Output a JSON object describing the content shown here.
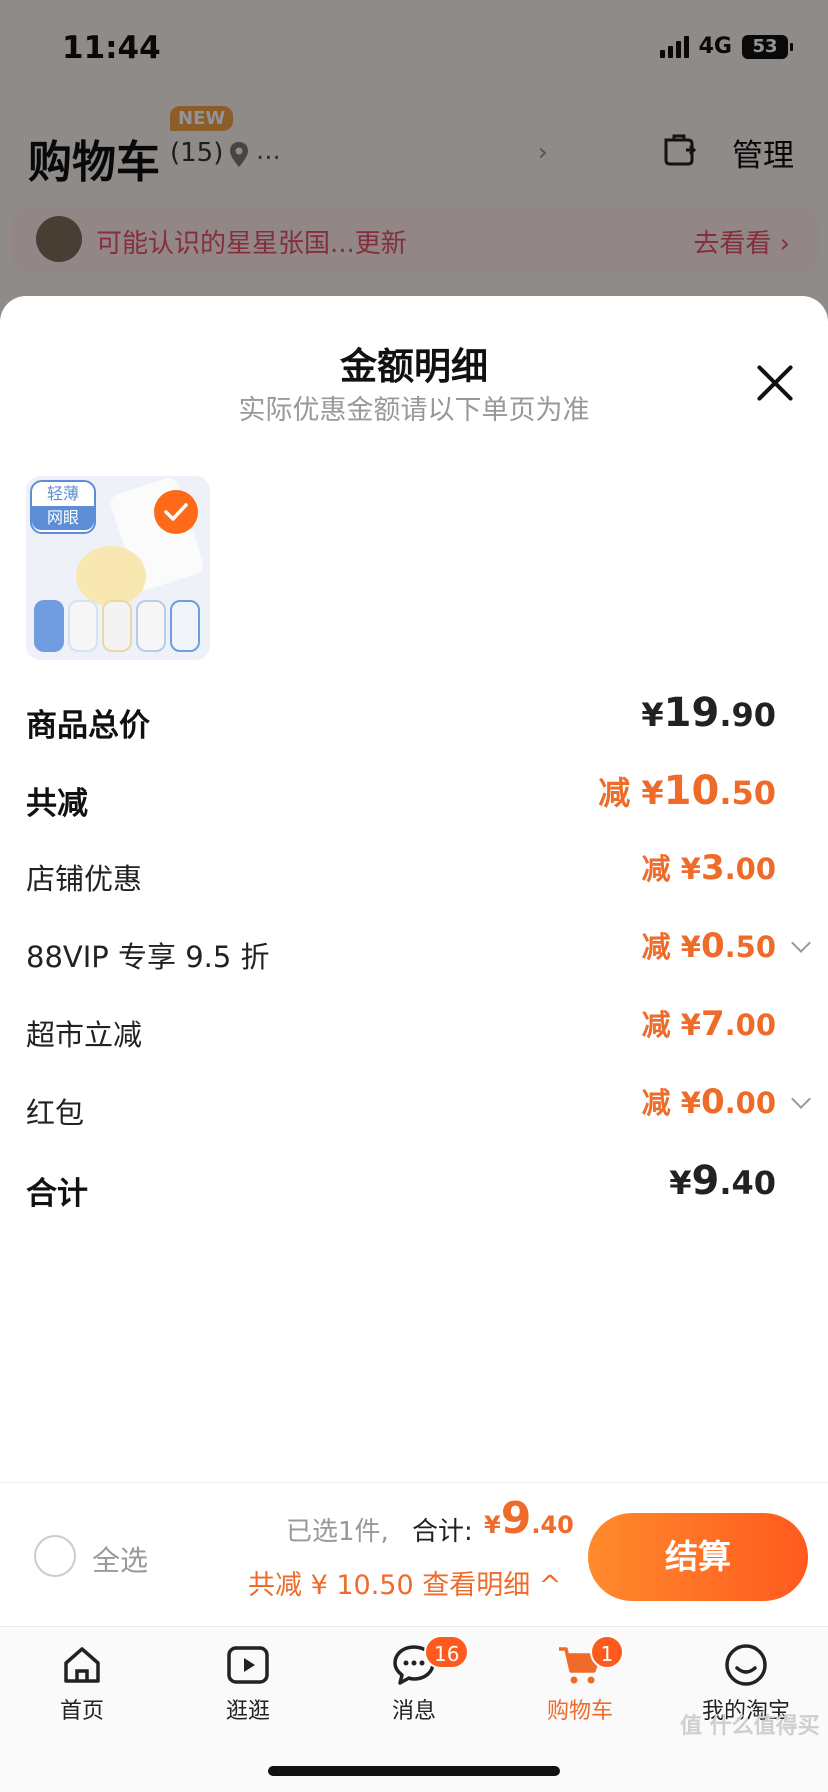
{
  "status_bar": {
    "time": "11:44",
    "network": "4G",
    "battery": "53"
  },
  "header": {
    "title": "购物车",
    "count": "(15)",
    "new_badge": "NEW",
    "location": "...",
    "manage": "管理"
  },
  "promo": {
    "text": "可能认识的星星张国...更新",
    "link": "去看看"
  },
  "sheet": {
    "title": "金额明细",
    "subtitle": "实际优惠金额请以下单页为准",
    "product": {
      "tag_top": "轻薄",
      "tag_bottom": "网眼",
      "selected": true
    },
    "rows": [
      {
        "label": "商品总价",
        "prefix": "",
        "yen": "¥",
        "int": "19",
        "dec": ".90",
        "color": "#222222"
      },
      {
        "label": "共减",
        "prefix": "减",
        "yen": "¥",
        "int": "10",
        "dec": ".50",
        "color": "#ee6b29"
      },
      {
        "label": "店铺优惠",
        "prefix": "减",
        "yen": "¥",
        "int": "3",
        "dec": ".00",
        "color": "#ee6b29"
      },
      {
        "label": "88VIP 专享 9.5 折",
        "prefix": "减",
        "yen": "¥",
        "int": "0",
        "dec": ".50",
        "color": "#ee6b29",
        "expandable": true
      },
      {
        "label": "超市立减",
        "prefix": "减",
        "yen": "¥",
        "int": "7",
        "dec": ".00",
        "color": "#ee6b29"
      },
      {
        "label": "红包",
        "prefix": "减",
        "yen": "¥",
        "int": "0",
        "dec": ".00",
        "color": "#ee6b29",
        "expandable": true
      },
      {
        "label": "合计",
        "prefix": "",
        "yen": "¥",
        "int": "9",
        "dec": ".40",
        "color": "#222222"
      }
    ]
  },
  "bottom_bar": {
    "select_all": "全选",
    "selected_info": "已选1件,",
    "total_label": "合计:",
    "total_yen": "¥",
    "total_int": "9",
    "total_dec": ".40",
    "discount_line": "共减 ¥ 10.50  查看明细 ^",
    "checkout": "结算"
  },
  "tabs": [
    {
      "label": "首页",
      "icon": "home-icon"
    },
    {
      "label": "逛逛",
      "icon": "play-icon"
    },
    {
      "label": "消息",
      "icon": "message-icon",
      "badge": "16"
    },
    {
      "label": "购物车",
      "icon": "cart-icon",
      "badge": "1",
      "active": true
    },
    {
      "label": "我的淘宝",
      "icon": "smile-icon"
    }
  ],
  "watermark": "值 什么值得买"
}
